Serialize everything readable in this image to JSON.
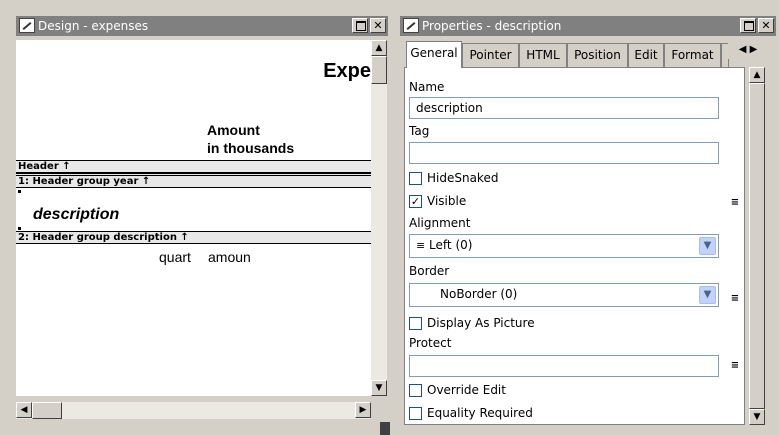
{
  "design_window": {
    "title": "Design - expenses",
    "header_text": "Expe",
    "amount_label": "Amount",
    "amount_label2": "in thousands",
    "bands": [
      "Header ↑",
      "1: Header group year ↑",
      "2: Header group description ↑"
    ],
    "description_field": "description",
    "quart_field": "quart",
    "amount_field": "amoun"
  },
  "properties_window": {
    "title": "Properties - description",
    "tabs": [
      "General",
      "Pointer",
      "HTML",
      "Position",
      "Edit",
      "Format"
    ],
    "name_label": "Name",
    "name_value": "description",
    "tag_label": "Tag",
    "tag_value": "",
    "hidesnaked_label": "HideSnaked",
    "hidesnaked_checked": false,
    "visible_label": "Visible",
    "visible_checked": true,
    "alignment_label": "Alignment",
    "alignment_value": "Left (0)",
    "border_label": "Border",
    "border_value": "NoBorder (0)",
    "display_as_picture_label": "Display As Picture",
    "protect_label": "Protect",
    "protect_value": "",
    "override_edit_label": "Override Edit",
    "equality_required_label": "Equality Required"
  }
}
